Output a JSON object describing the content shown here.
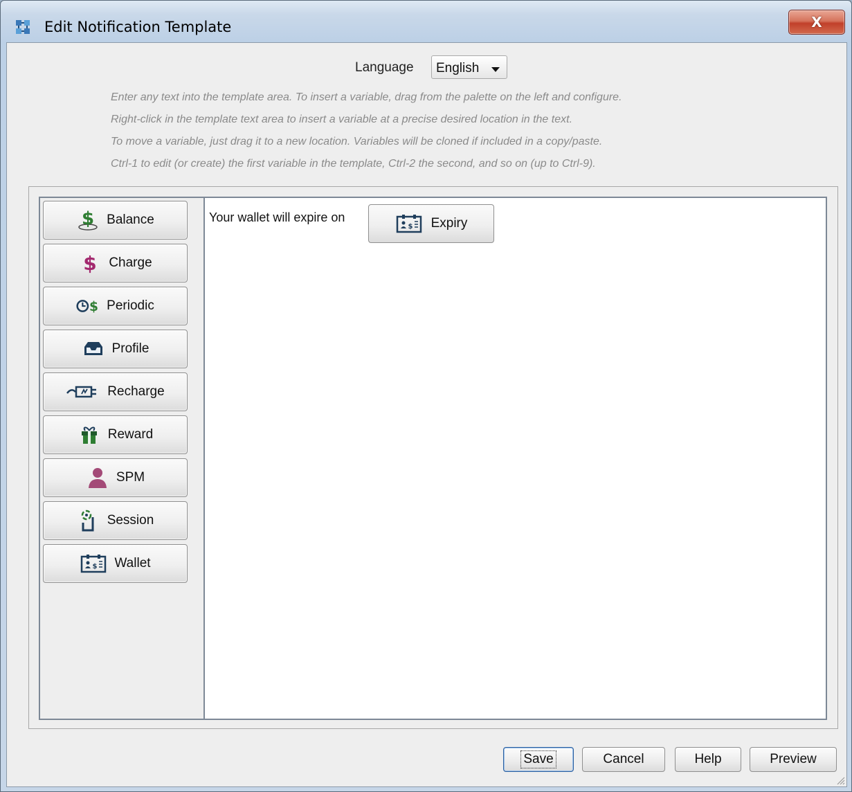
{
  "window": {
    "title": "Edit Notification Template",
    "close_label": "X"
  },
  "language": {
    "label": "Language",
    "selected": "English"
  },
  "instructions": [
    "Enter any text into the template area.  To insert a variable, drag from the palette on the left and configure.",
    "Right-click in the template text area to insert a variable at a precise desired location in the text.",
    "To move a variable, just drag it to a new location.  Variables will be cloned if included in a copy/paste.",
    "Ctrl-1 to edit (or create) the first variable in the template, Ctrl-2 the second, and so on (up to Ctrl-9)."
  ],
  "palette": {
    "items": [
      {
        "label": "Balance",
        "icon": "balance-dollar-icon"
      },
      {
        "label": "Charge",
        "icon": "dollar-icon"
      },
      {
        "label": "Periodic",
        "icon": "clock-dollar-icon"
      },
      {
        "label": "Profile",
        "icon": "inbox-tray-icon"
      },
      {
        "label": "Recharge",
        "icon": "charger-plug-icon"
      },
      {
        "label": "Reward",
        "icon": "gift-icon"
      },
      {
        "label": "SPM",
        "icon": "user-icon"
      },
      {
        "label": "Session",
        "icon": "mobile-signal-icon"
      },
      {
        "label": "Wallet",
        "icon": "wallet-card-icon"
      }
    ]
  },
  "template": {
    "text": "Your wallet will expire on",
    "variable": {
      "label": "Expiry",
      "icon": "wallet-card-icon"
    }
  },
  "buttons": {
    "save": "Save",
    "cancel": "Cancel",
    "help": "Help",
    "preview": "Preview"
  },
  "colors": {
    "dollar_green": "#2e7d32",
    "dollar_magenta": "#a3286e",
    "icon_navy": "#1f3e5c",
    "spm_purple": "#a34a77"
  }
}
